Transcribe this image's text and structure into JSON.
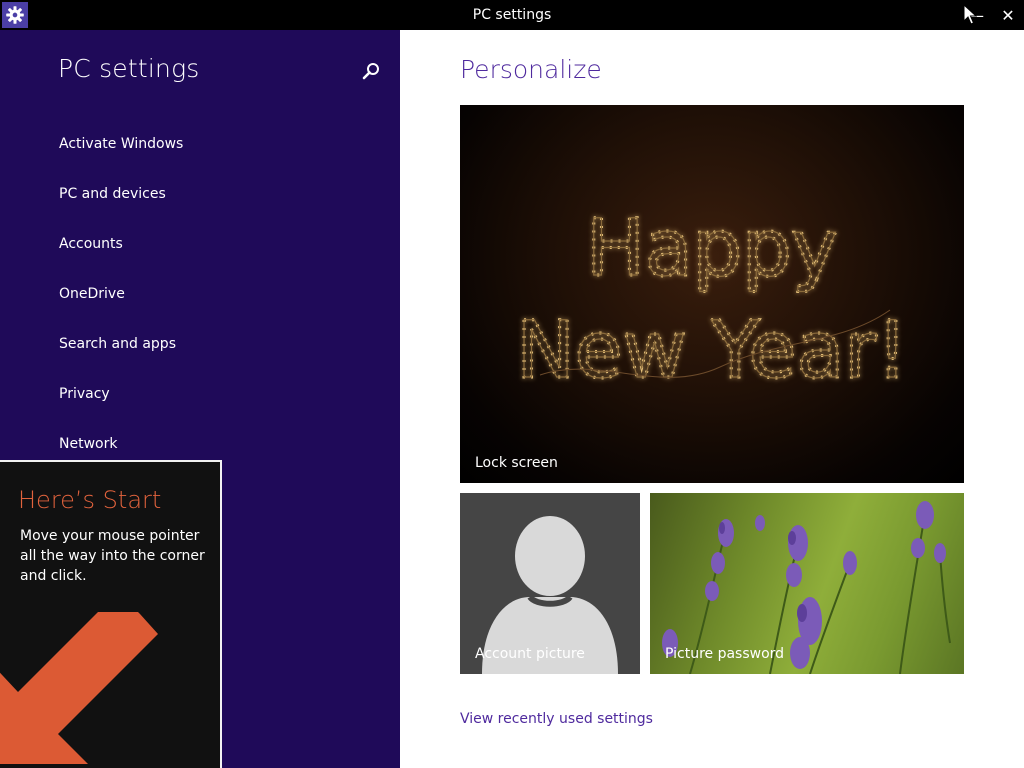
{
  "window": {
    "title": "PC settings",
    "minimize_glyph": "—",
    "close_glyph": "✕"
  },
  "sidebar": {
    "title": "PC settings",
    "items": [
      {
        "label": "Activate Windows"
      },
      {
        "label": "PC and devices"
      },
      {
        "label": "Accounts"
      },
      {
        "label": "OneDrive"
      },
      {
        "label": "Search and apps"
      },
      {
        "label": "Privacy"
      },
      {
        "label": "Network"
      }
    ]
  },
  "start_tip": {
    "title": "Here’s Start",
    "body": "Move your mouse pointer all the way into the corner and click."
  },
  "main": {
    "title": "Personalize",
    "tiles": {
      "lock_screen": {
        "label": "Lock screen",
        "image_text_line1": "Happy",
        "image_text_line2": "New Year!"
      },
      "account_picture": {
        "label": "Account picture"
      },
      "picture_password": {
        "label": "Picture password"
      }
    },
    "recent_link": "View recently used settings"
  },
  "colors": {
    "sidebar_bg": "#1f0a59",
    "accent_text": "#4f2a9e",
    "tip_title": "#e2633d",
    "tip_arrow": "#dc5a34",
    "app_icon_bg": "#4b3fa6"
  },
  "icons": {
    "app": "gear-icon",
    "search": "search-icon",
    "tip_arrow": "arrow-down-left-icon"
  }
}
